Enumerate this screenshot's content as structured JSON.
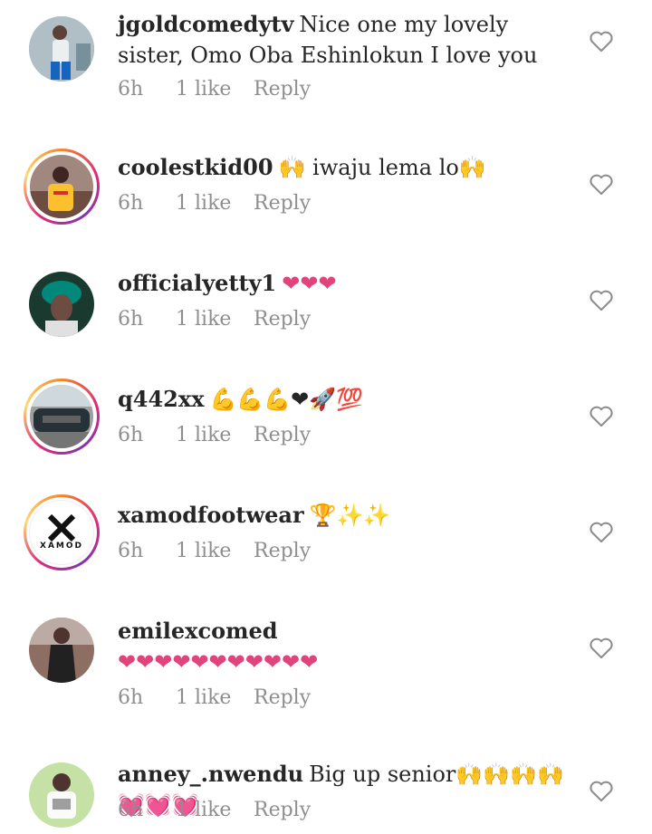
{
  "comments": [
    {
      "username": "jgoldcomedytv",
      "text": "Nice one my lovely sister, Omo Oba Eshinlokun I love you",
      "time": "6h",
      "likes": "1 like",
      "reply": "Reply"
    },
    {
      "username": "coolestkid00",
      "text": "🙌 iwaju lema lo🙌",
      "time": "6h",
      "likes": "1 like",
      "reply": "Reply"
    },
    {
      "username": "officialyetty1",
      "text": "❤❤❤",
      "time": "6h",
      "likes": "1 like",
      "reply": "Reply"
    },
    {
      "username": "q442xx",
      "text": "💪💪💪❤🚀💯",
      "time": "6h",
      "likes": "1 like",
      "reply": "Reply"
    },
    {
      "username": "xamodfootwear",
      "text": "🏆✨✨",
      "time": "6h",
      "likes": "1 like",
      "reply": "Reply"
    },
    {
      "username": "emilexcomed",
      "text": "❤❤❤❤❤❤❤❤❤❤❤",
      "time": "6h",
      "likes": "1 like",
      "reply": "Reply"
    },
    {
      "username": "anney_.nwendu",
      "text": "Big up senior🙌🙌🙌🙌💓💓💓",
      "time": "6h",
      "likes": "1 like",
      "reply": "Reply"
    }
  ],
  "xamod_logo": "XAMOD",
  "colors": {
    "heart_emoji": "#e0447a",
    "meta_gray": "#8e8e8e",
    "text": "#262626"
  }
}
